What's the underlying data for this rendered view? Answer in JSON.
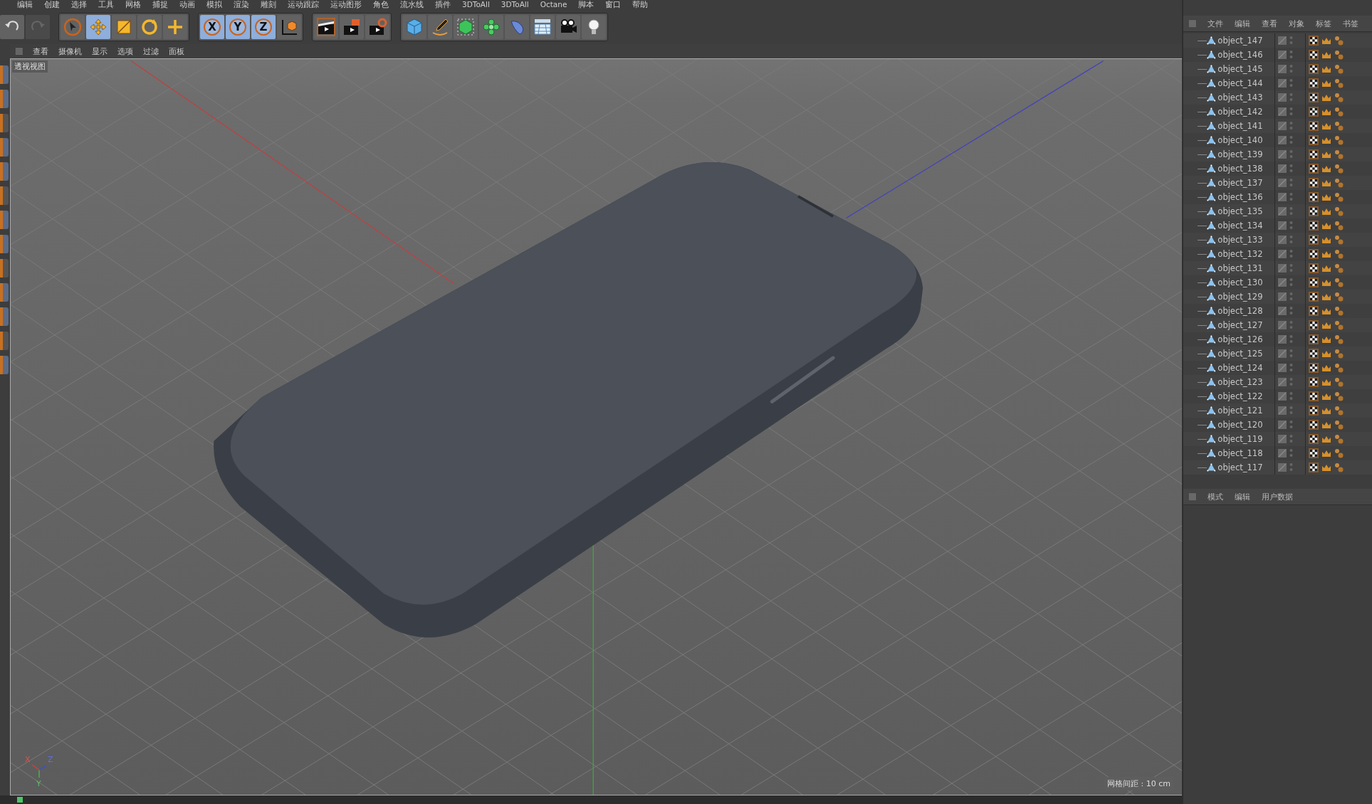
{
  "menu_bar": [
    "编辑",
    "创建",
    "选择",
    "工具",
    "网格",
    "捕捉",
    "动画",
    "模拟",
    "渲染",
    "雕刻",
    "运动跟踪",
    "运动图形",
    "角色",
    "流水线",
    "插件",
    "3DToAll",
    "3DToAll",
    "Octane",
    "脚本",
    "窗口",
    "帮助"
  ],
  "toolbar": {
    "history": [
      {
        "kind": "undo",
        "disabled": false
      },
      {
        "kind": "redo",
        "disabled": true
      }
    ],
    "tools": [
      {
        "kind": "select",
        "selected": false
      },
      {
        "kind": "move",
        "selected": true
      },
      {
        "kind": "scale",
        "selected": false
      },
      {
        "kind": "rotate",
        "selected": false
      },
      {
        "kind": "transform",
        "selected": false
      }
    ],
    "axis_locks": [
      {
        "label": "X",
        "selected": true
      },
      {
        "label": "Y",
        "selected": true
      },
      {
        "label": "Z",
        "selected": true
      }
    ],
    "render": [
      {
        "kind": "render-view"
      },
      {
        "kind": "render-picture"
      },
      {
        "kind": "render-settings"
      }
    ],
    "objects": [
      {
        "kind": "cube"
      },
      {
        "kind": "pen"
      },
      {
        "kind": "subdivision"
      },
      {
        "kind": "cloner"
      },
      {
        "kind": "deformer"
      },
      {
        "kind": "floor"
      },
      {
        "kind": "camera"
      },
      {
        "kind": "light"
      }
    ]
  },
  "viewport": {
    "menu": [
      "查看",
      "摄像机",
      "显示",
      "选项",
      "过滤",
      "面板"
    ],
    "label": "透视视图",
    "grid_spacing": "网格间距 : 10 cm",
    "gizmo": [
      "X",
      "Y",
      "Z"
    ]
  },
  "object_manager": {
    "tabs": [
      "文件",
      "编辑",
      "查看",
      "对象",
      "标签",
      "书签"
    ],
    "objects": [
      {
        "name": "object_147"
      },
      {
        "name": "object_146"
      },
      {
        "name": "object_145"
      },
      {
        "name": "object_144"
      },
      {
        "name": "object_143"
      },
      {
        "name": "object_142"
      },
      {
        "name": "object_141"
      },
      {
        "name": "object_140"
      },
      {
        "name": "object_139"
      },
      {
        "name": "object_138"
      },
      {
        "name": "object_137"
      },
      {
        "name": "object_136"
      },
      {
        "name": "object_135"
      },
      {
        "name": "object_134"
      },
      {
        "name": "object_133"
      },
      {
        "name": "object_132"
      },
      {
        "name": "object_131"
      },
      {
        "name": "object_130"
      },
      {
        "name": "object_129"
      },
      {
        "name": "object_128"
      },
      {
        "name": "object_127"
      },
      {
        "name": "object_126"
      },
      {
        "name": "object_125"
      },
      {
        "name": "object_124"
      },
      {
        "name": "object_123"
      },
      {
        "name": "object_122"
      },
      {
        "name": "object_121"
      },
      {
        "name": "object_120"
      },
      {
        "name": "object_119"
      },
      {
        "name": "object_118"
      },
      {
        "name": "object_117"
      }
    ]
  },
  "attribute_manager": {
    "tabs": [
      "模式",
      "编辑",
      "用户数据"
    ]
  }
}
